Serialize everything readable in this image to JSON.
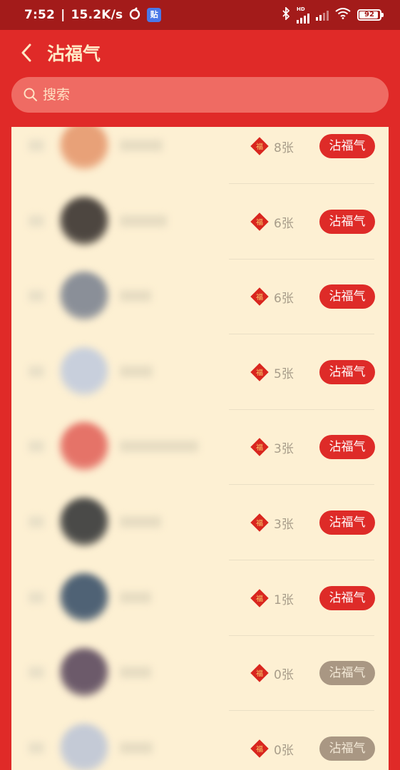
{
  "status_bar": {
    "time": "7:52",
    "speed": "15.2K/s",
    "app_badge": "贴",
    "network_label": "HD",
    "battery": "92",
    "battery_level": 0.92
  },
  "header": {
    "title": "沾福气"
  },
  "search": {
    "placeholder": "搜索"
  },
  "colors": {
    "background_red": "#e02a28",
    "list_background": "#fdf0d3",
    "button_active": "#de2b28",
    "button_disabled": "#a99783",
    "title_text": "#ffe9c6"
  },
  "list": {
    "items": [
      {
        "count": "8张",
        "button": "沾福气",
        "button_state": "active",
        "avatar_color": "#e8a178"
      },
      {
        "count": "6张",
        "button": "沾福气",
        "button_state": "active",
        "avatar_color": "#4d4640"
      },
      {
        "count": "6张",
        "button": "沾福气",
        "button_state": "active",
        "avatar_color": "#8a8f98"
      },
      {
        "count": "5张",
        "button": "沾福气",
        "button_state": "active",
        "avatar_color": "#c8cfdc"
      },
      {
        "count": "3张",
        "button": "沾福气",
        "button_state": "active",
        "avatar_color": "#e57368"
      },
      {
        "count": "3张",
        "button": "沾福气",
        "button_state": "active",
        "avatar_color": "#4a4a48"
      },
      {
        "count": "1张",
        "button": "沾福气",
        "button_state": "active",
        "avatar_color": "#4f6275"
      },
      {
        "count": "0张",
        "button": "沾福气",
        "button_state": "disabled",
        "avatar_color": "#6c5a6a"
      },
      {
        "count": "0张",
        "button": "沾福气",
        "button_state": "disabled",
        "avatar_color": "#c4cad6"
      }
    ]
  }
}
